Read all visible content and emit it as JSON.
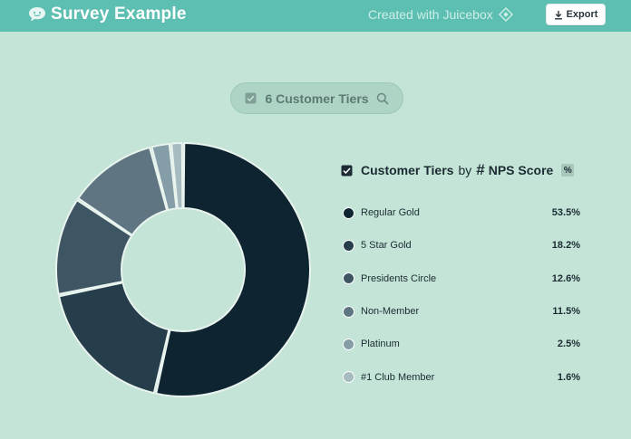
{
  "header": {
    "title": "Survey Example",
    "created_with": "Created with Juicebox",
    "export_label": "Export"
  },
  "filter": {
    "label": "6 Customer Tiers"
  },
  "legend": {
    "dimension": "Customer Tiers",
    "by": "by",
    "hash": "#",
    "metric": "NPS Score",
    "percent_toggle": "%"
  },
  "colors": {
    "header_bg": "#5dbfb1",
    "page_bg": "#c3e4d6"
  },
  "chart_data": {
    "type": "pie",
    "variant": "donut",
    "categories": [
      "Regular Gold",
      "5 Star Gold",
      "Presidents Circle",
      "Non-Member",
      "Platinum",
      "#1 Club Member"
    ],
    "values": [
      53.5,
      18.2,
      12.6,
      11.5,
      2.5,
      1.6
    ],
    "value_labels": [
      "53.5%",
      "18.2%",
      "12.6%",
      "11.5%",
      "2.5%",
      "1.6%"
    ],
    "colors": [
      "#0e2531",
      "#263d4b",
      "#3e5664",
      "#5f7682",
      "#849da6",
      "#a6bcc1"
    ],
    "legend_position": "right"
  }
}
